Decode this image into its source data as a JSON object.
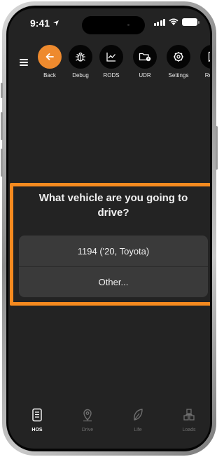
{
  "status_bar": {
    "time": "9:41"
  },
  "toolbar": {
    "items": [
      {
        "label": "Back",
        "icon": "arrow-left-icon"
      },
      {
        "label": "Debug",
        "icon": "bug-icon"
      },
      {
        "label": "RODS",
        "icon": "line-chart-icon"
      },
      {
        "label": "UDR",
        "icon": "folder-alert-icon"
      },
      {
        "label": "Settings",
        "icon": "gear-icon"
      },
      {
        "label": "Recei",
        "icon": "receipt-icon"
      }
    ]
  },
  "dialog": {
    "title": "What vehicle are you going to drive?",
    "options": [
      "1194 ('20, Toyota)",
      "Other..."
    ]
  },
  "bottom_nav": {
    "items": [
      {
        "label": "HOS",
        "icon": "logbook-icon",
        "active": true
      },
      {
        "label": "Drive",
        "icon": "map-pin-icon",
        "active": false
      },
      {
        "label": "Life",
        "icon": "leaf-icon",
        "active": false
      },
      {
        "label": "Loads",
        "icon": "boxes-icon",
        "active": false
      }
    ]
  },
  "colors": {
    "accent": "#ee8a2e",
    "highlight": "#f58a1f",
    "background": "#232323",
    "option_bg": "#3a3a3a"
  }
}
